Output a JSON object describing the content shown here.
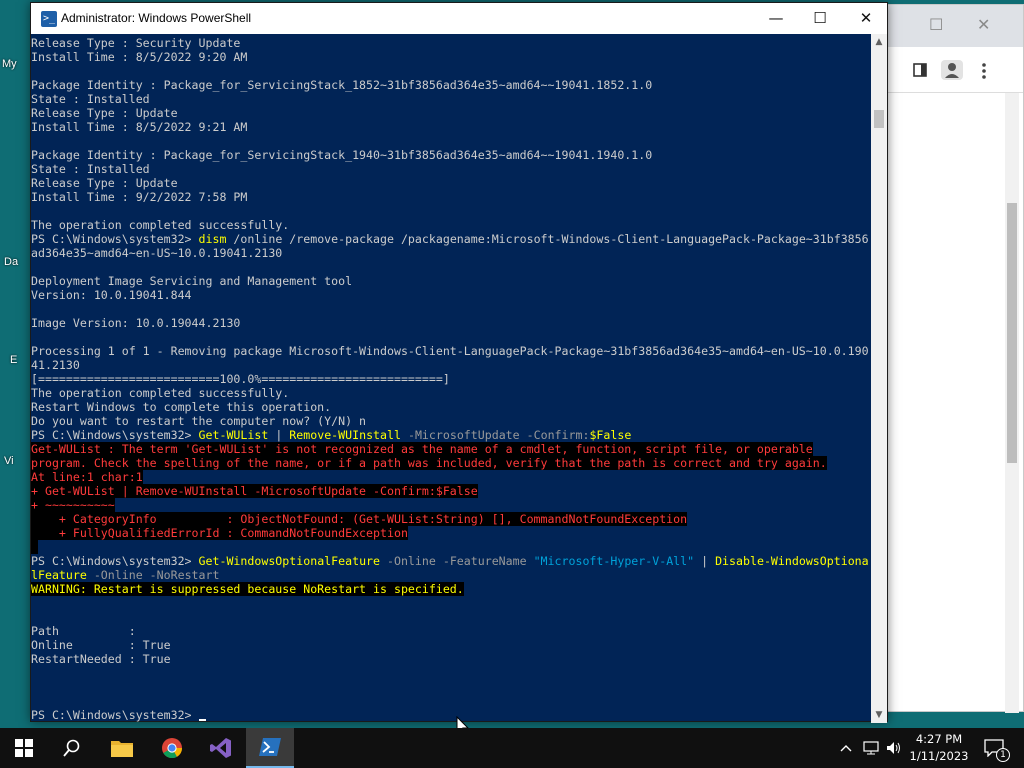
{
  "desktop": {
    "icon_fragments": [
      "My",
      "Da",
      "E",
      "Vi"
    ]
  },
  "powershell": {
    "title": "Administrator: Windows PowerShell",
    "caption_buttons": {
      "minimize": "—",
      "maximize": "☐",
      "close": "✕"
    },
    "lines": [
      [
        {
          "t": "Release Type : Security Update"
        }
      ],
      [
        {
          "t": "Install Time : 8/5/2022 9:20 AM"
        }
      ],
      [
        {
          "t": ""
        }
      ],
      [
        {
          "t": "Package Identity : Package_for_ServicingStack_1852~31bf3856ad364e35~amd64~~19041.1852.1.0"
        }
      ],
      [
        {
          "t": "State : Installed"
        }
      ],
      [
        {
          "t": "Release Type : Update"
        }
      ],
      [
        {
          "t": "Install Time : 8/5/2022 9:21 AM"
        }
      ],
      [
        {
          "t": ""
        }
      ],
      [
        {
          "t": "Package Identity : Package_for_ServicingStack_1940~31bf3856ad364e35~amd64~~19041.1940.1.0"
        }
      ],
      [
        {
          "t": "State : Installed"
        }
      ],
      [
        {
          "t": "Release Type : Update"
        }
      ],
      [
        {
          "t": "Install Time : 9/2/2022 7:58 PM"
        }
      ],
      [
        {
          "t": ""
        }
      ],
      [
        {
          "t": "The operation completed successfully."
        }
      ],
      [
        {
          "t": "PS C:\\Windows\\system32> "
        },
        {
          "t": "dism",
          "c": "y"
        },
        {
          "t": " /online /remove-package /packagename:Microsoft-Windows-Client-LanguagePack-Package~31bf3856"
        }
      ],
      [
        {
          "t": "ad364e35~amd64~en-US~10.0.19041.2130"
        }
      ],
      [
        {
          "t": ""
        }
      ],
      [
        {
          "t": "Deployment Image Servicing and Management tool"
        }
      ],
      [
        {
          "t": "Version: 10.0.19041.844"
        }
      ],
      [
        {
          "t": ""
        }
      ],
      [
        {
          "t": "Image Version: 10.0.19044.2130"
        }
      ],
      [
        {
          "t": ""
        }
      ],
      [
        {
          "t": "Processing 1 of 1 - Removing package Microsoft-Windows-Client-LanguagePack-Package~31bf3856ad364e35~amd64~en-US~10.0.190"
        }
      ],
      [
        {
          "t": "41.2130"
        }
      ],
      [
        {
          "t": "[==========================100.0%==========================]"
        }
      ],
      [
        {
          "t": "The operation completed successfully."
        }
      ],
      [
        {
          "t": "Restart Windows to complete this operation."
        }
      ],
      [
        {
          "t": "Do you want to restart the computer now? (Y/N) n"
        }
      ],
      [
        {
          "t": "PS C:\\Windows\\system32> "
        },
        {
          "t": "Get-WUList",
          "c": "y"
        },
        {
          "t": " | "
        },
        {
          "t": "Remove-WUInstall",
          "c": "y"
        },
        {
          "t": " -MicrosoftUpdate -Confirm:",
          "c": "c"
        },
        {
          "t": "$False",
          "c": "v"
        }
      ],
      [
        {
          "t": "Get-WUList : The term 'Get-WUList' is not recognized as the name of a cmdlet, function, script file, or operable",
          "c": "err"
        }
      ],
      [
        {
          "t": "program. Check the spelling of the name, or if a path was included, verify that the path is correct and try again.",
          "c": "err"
        }
      ],
      [
        {
          "t": "At line:1 char:1",
          "c": "err"
        }
      ],
      [
        {
          "t": "+ Get-WUList | Remove-WUInstall -MicrosoftUpdate -Confirm:$False",
          "c": "err"
        }
      ],
      [
        {
          "t": "+ ~~~~~~~~~~",
          "c": "err"
        }
      ],
      [
        {
          "t": "    + CategoryInfo          : ObjectNotFound: (Get-WUList:String) [], CommandNotFoundException",
          "c": "err"
        }
      ],
      [
        {
          "t": "    + FullyQualifiedErrorId : CommandNotFoundException",
          "c": "err"
        }
      ],
      [
        {
          "t": " ",
          "c": "err"
        }
      ],
      [
        {
          "t": "PS C:\\Windows\\system32> "
        },
        {
          "t": "Get-WindowsOptionalFeature",
          "c": "y"
        },
        {
          "t": " -Online -FeatureName ",
          "c": "c"
        },
        {
          "t": "\"Microsoft-Hyper-V-All\"",
          "c": "tn"
        },
        {
          "t": " | "
        },
        {
          "t": "Disable-WindowsOptiona",
          "c": "y"
        }
      ],
      [
        {
          "t": "lFeature",
          "c": "y"
        },
        {
          "t": " -Online -NoRestart",
          "c": "c"
        }
      ],
      [
        {
          "t": "WARNING: Restart is suppressed because NoRestart is specified.",
          "c": "warn"
        }
      ],
      [
        {
          "t": ""
        }
      ],
      [
        {
          "t": ""
        }
      ],
      [
        {
          "t": "Path          :"
        }
      ],
      [
        {
          "t": "Online        : True"
        }
      ],
      [
        {
          "t": "RestartNeeded : True"
        }
      ],
      [
        {
          "t": ""
        }
      ],
      [
        {
          "t": ""
        }
      ],
      [
        {
          "t": ""
        }
      ],
      [
        {
          "t": "PS C:\\Windows\\system32> "
        },
        {
          "t": "",
          "c": "cursor"
        }
      ]
    ]
  },
  "taskbar": {
    "items": [
      "start",
      "search",
      "file-explorer",
      "chrome",
      "visual-studio",
      "powershell"
    ],
    "clock_time": "4:27 PM",
    "clock_date": "1/11/2023",
    "notification_count": "1"
  }
}
